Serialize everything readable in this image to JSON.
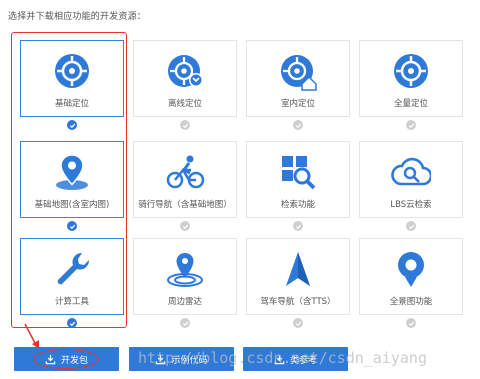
{
  "instruction": "选择并下载相应功能的开发资源：",
  "colors": {
    "accent": "#2f7ad9",
    "icon_blue": "#2f7ad9",
    "annotation_red": "#e8332d",
    "check_gray": "#cfcfcf"
  },
  "tiles": [
    {
      "label": "基础定位",
      "icon": "crosshair-icon",
      "selected": true
    },
    {
      "label": "离线定位",
      "icon": "offline-location-icon",
      "selected": false
    },
    {
      "label": "室内定位",
      "icon": "indoor-location-icon",
      "selected": false
    },
    {
      "label": "全量定位",
      "icon": "full-location-icon",
      "selected": false
    },
    {
      "label": "基础地图(含室内图)",
      "icon": "map-pin-icon",
      "selected": true
    },
    {
      "label": "骑行导航（含基础地图）",
      "icon": "cyclist-icon",
      "selected": false
    },
    {
      "label": "检索功能",
      "icon": "search-grid-icon",
      "selected": false
    },
    {
      "label": "LBS云检索",
      "icon": "cloud-search-icon",
      "selected": false
    },
    {
      "label": "计算工具",
      "icon": "wrench-icon",
      "selected": true
    },
    {
      "label": "周边雷达",
      "icon": "radar-icon",
      "selected": false
    },
    {
      "label": "驾车导航（含TTS）",
      "icon": "navigation-arrow-icon",
      "selected": false
    },
    {
      "label": "全景图功能",
      "icon": "panorama-icon",
      "selected": false
    }
  ],
  "buttons": {
    "download": "开发包",
    "sample": "示例代码",
    "reference": "类参考"
  },
  "watermark": "http://blog.csdn.net/csdn_aiyang"
}
